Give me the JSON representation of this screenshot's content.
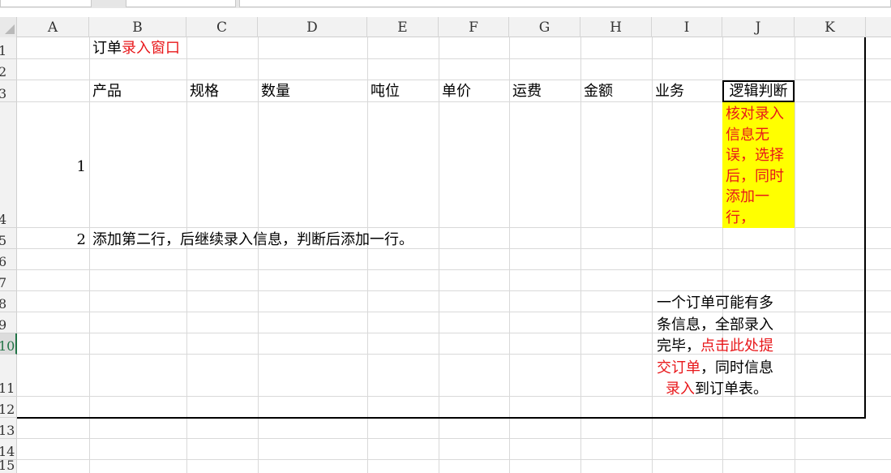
{
  "columns": [
    "A",
    "B",
    "C",
    "D",
    "E",
    "F",
    "G",
    "H",
    "I",
    "J",
    "K"
  ],
  "rows": [
    "1",
    "2",
    "3",
    "4",
    "5",
    "6",
    "7",
    "8",
    "9",
    "10",
    "11",
    "12",
    "13",
    "14",
    "15"
  ],
  "selected_row": "10",
  "cells": {
    "B1_prefix": "订单",
    "B1_red": "录入窗口",
    "headers": [
      "产品",
      "规格",
      "数量",
      "吨位",
      "单价",
      "运费",
      "金额",
      "业务"
    ],
    "J3": "逻辑判断",
    "A4": "1",
    "J4_lines": [
      "核对录入",
      "信息无",
      "误，选择",
      "后，同时",
      "添加一",
      "行，"
    ],
    "A5": "2",
    "B5": "添加第二行，后继续录入信息，判断后添加一行。",
    "note": {
      "line1": "一个订单可能有多",
      "line2": "条信息，全部录入",
      "line3_black": "完毕，",
      "line3_red": "点击此处提",
      "line4_red": "交订单",
      "line4_black": "，同时信息",
      "line5_red": "录入",
      "line5_black": "到订单表。"
    }
  },
  "colors": {
    "highlight": "#ffff00",
    "red_text": "#e8171a",
    "selection_green": "#217346"
  }
}
